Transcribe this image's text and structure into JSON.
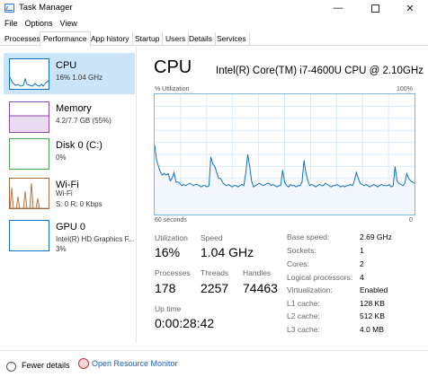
{
  "window": {
    "title": "Task Manager"
  },
  "menu": [
    "File",
    "Options",
    "View"
  ],
  "tabs": [
    "Processes",
    "Performance",
    "App history",
    "Startup",
    "Users",
    "Details",
    "Services"
  ],
  "active_tab": "Performance",
  "sidebar": [
    {
      "name": "CPU",
      "sub": "16% 1.04 GHz",
      "active": true
    },
    {
      "name": "Memory",
      "sub": "4.2/7.7 GB (55%)"
    },
    {
      "name": "Disk 0 (C:)",
      "sub": "0%"
    },
    {
      "name": "Wi-Fi",
      "sub": "Wi-Fi",
      "sub2": "S: 0 R: 0 Kbps"
    },
    {
      "name": "GPU 0",
      "sub": "Intel(R) HD Graphics F...",
      "sub2": "3%"
    }
  ],
  "main": {
    "title": "CPU",
    "model": "Intel(R) Core(TM) i7-4600U CPU @ 2.10GHz",
    "graph_top_left": "% Utilization",
    "graph_top_right": "100%",
    "graph_bottom_left": "60 seconds",
    "graph_bottom_right": "0"
  },
  "stats": {
    "utilization": {
      "label": "Utilization",
      "value": "16%"
    },
    "speed": {
      "label": "Speed",
      "value": "1.04 GHz"
    },
    "processes": {
      "label": "Processes",
      "value": "178"
    },
    "threads": {
      "label": "Threads",
      "value": "2257"
    },
    "handles": {
      "label": "Handles",
      "value": "74463"
    },
    "uptime": {
      "label": "Up time",
      "value": "0:00:28:42"
    }
  },
  "specs": [
    {
      "label": "Base speed:",
      "value": "2.69 GHz"
    },
    {
      "label": "Sockets:",
      "value": "1"
    },
    {
      "label": "Cores:",
      "value": "2"
    },
    {
      "label": "Logical processors:",
      "value": "4"
    },
    {
      "label": "Virtualization:",
      "value": "Enabled"
    },
    {
      "label": "L1 cache:",
      "value": "128 KB"
    },
    {
      "label": "L2 cache:",
      "value": "512 KB"
    },
    {
      "label": "L3 cache:",
      "value": "4.0 MB"
    }
  ],
  "footer": {
    "fewer": "Fewer details",
    "monitor": "Open Resource Monitor"
  },
  "colors": {
    "accent": "#1170c4",
    "cpu_line": "#1170c4",
    "memory": "#8b4aa8",
    "disk": "#4aa64a",
    "wifi": "#a4683a",
    "selected": "#cce4f7"
  },
  "cpu_history": [
    58,
    45,
    40,
    35,
    33,
    34,
    33,
    34,
    28,
    30,
    35,
    27,
    27,
    26,
    24,
    25,
    24,
    25,
    26,
    25,
    24,
    25,
    25,
    24,
    23,
    24,
    24,
    23,
    24,
    48,
    42,
    40,
    35,
    30,
    30,
    27,
    25,
    24,
    25,
    24,
    23,
    24,
    24,
    23,
    24,
    25,
    24,
    35,
    50,
    40,
    28,
    23,
    24,
    25,
    26,
    25,
    24,
    25,
    26,
    26,
    24,
    25,
    24,
    23,
    24,
    24,
    37,
    27,
    24,
    23,
    25,
    24,
    24,
    23,
    24,
    24,
    27,
    45,
    35,
    28,
    24,
    25,
    24,
    23,
    24,
    25,
    24,
    24,
    26,
    25,
    24,
    23,
    24,
    24,
    25,
    24,
    23,
    24,
    23,
    24,
    24,
    25,
    24,
    28,
    35,
    30,
    26,
    25,
    24,
    25,
    24,
    23,
    24,
    25,
    24,
    23,
    24,
    25,
    24,
    24,
    24,
    25,
    23,
    24,
    40,
    28,
    26,
    25,
    24,
    26,
    34,
    30,
    28,
    27,
    26
  ]
}
